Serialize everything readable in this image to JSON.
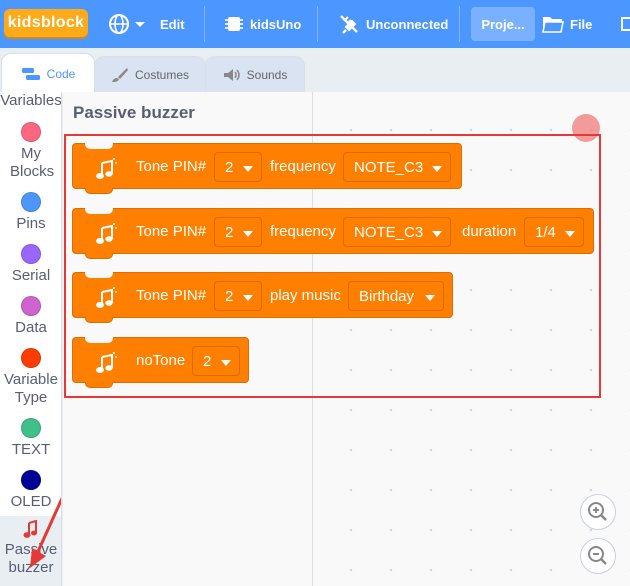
{
  "menubar": {
    "logo": "kidsblock",
    "edit": "Edit",
    "device": "kidsUno",
    "connection": "Unconnected",
    "project": "Proje...",
    "file": "File"
  },
  "tabs": {
    "code": "Code",
    "costumes": "Costumes",
    "sounds": "Sounds"
  },
  "categories": [
    {
      "label": "Variables",
      "color": ""
    },
    {
      "label": "My Blocks",
      "color": "#ff6680"
    },
    {
      "label": "Pins",
      "color": "#4c97ff"
    },
    {
      "label": "Serial",
      "color": "#9966ff"
    },
    {
      "label": "Data",
      "color": "#cf63cf"
    },
    {
      "label": "Variable Type",
      "color": "#ff3d00"
    },
    {
      "label": "TEXT",
      "color": "#40bf8a"
    },
    {
      "label": "OLED",
      "color": "#000099"
    },
    {
      "label": "Passive buzzer",
      "color": "#e53935"
    }
  ],
  "palette": {
    "title": "Passive buzzer",
    "blocks": [
      {
        "t1": "Tone PIN#",
        "pin": "2",
        "t2": "frequency",
        "note": "NOTE_C3"
      },
      {
        "t1": "Tone PIN#",
        "pin": "2",
        "t2": "frequency",
        "note": "NOTE_C3",
        "t3": "duration",
        "dur": "1/4"
      },
      {
        "t1": "Tone PIN#",
        "pin": "2",
        "t2": "play music",
        "song": "Birthday"
      },
      {
        "t1": "noTone",
        "pin": "2"
      }
    ]
  },
  "zoom": {
    "in_icon": "zoom-in-icon",
    "out_icon": "zoom-out-icon"
  },
  "colors": {
    "menubar": "#4c97ff",
    "block": "#ff7f00",
    "logo": "#ffab19",
    "highlight": "#e53935"
  }
}
